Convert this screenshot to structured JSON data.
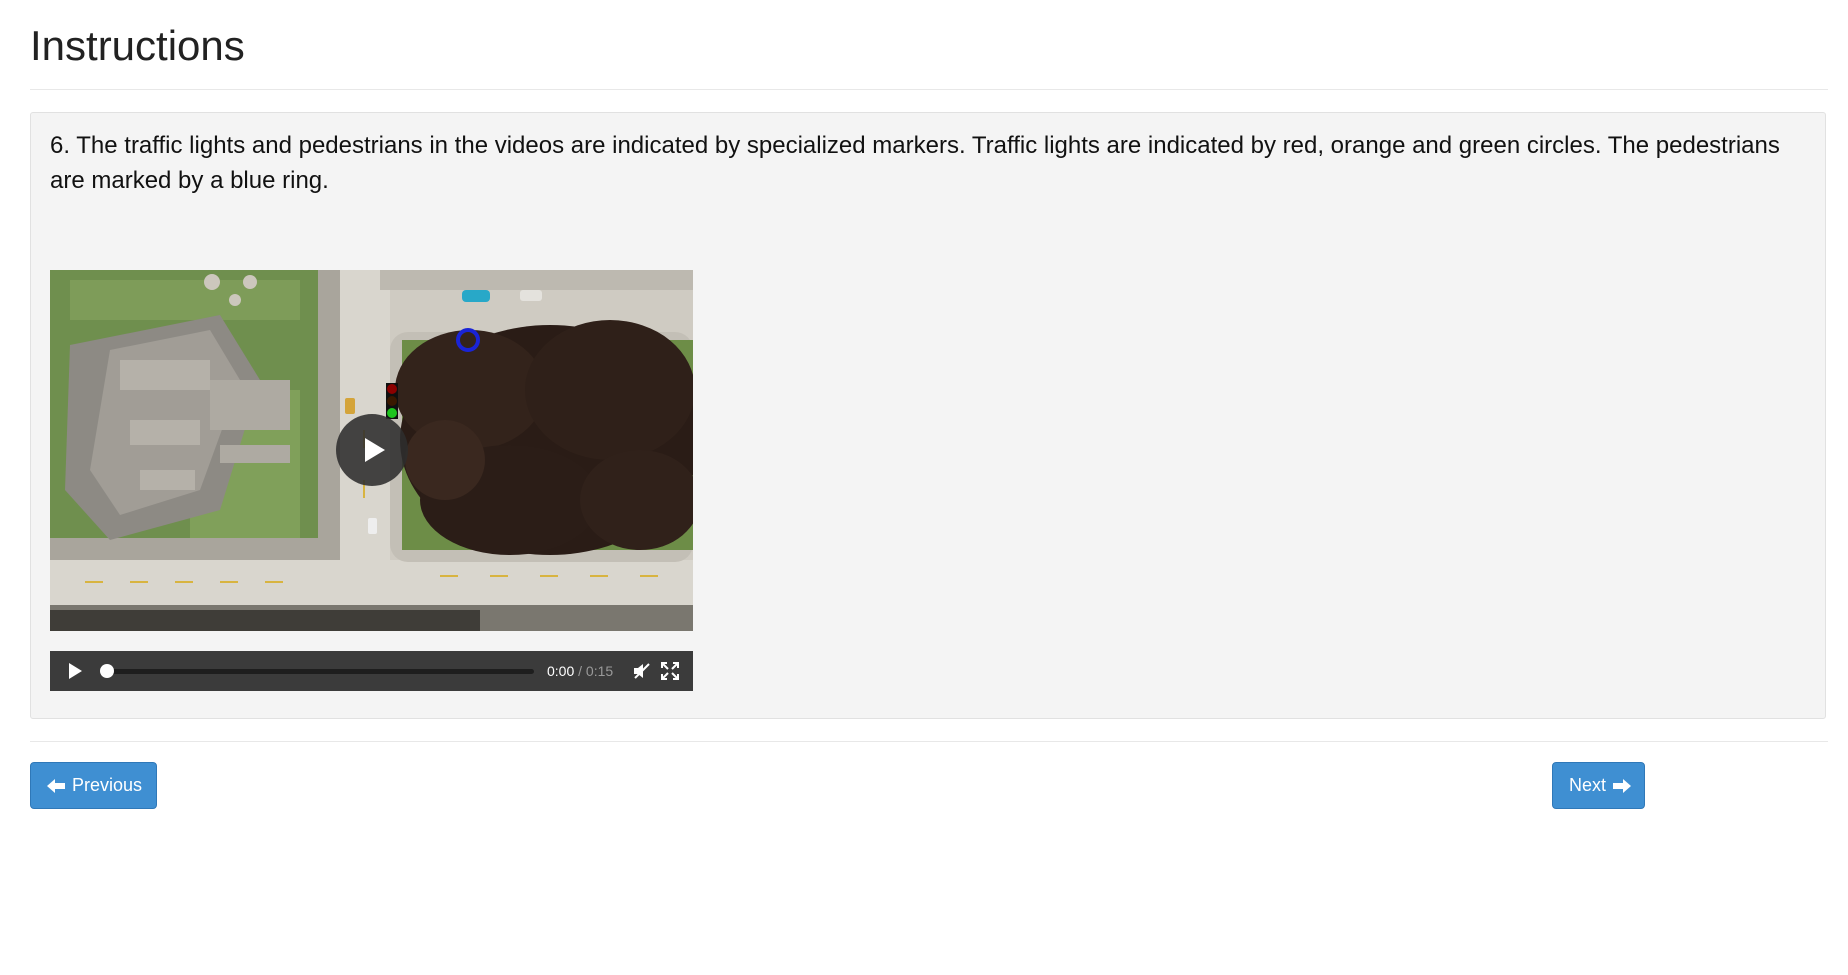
{
  "header": {
    "title": "Instructions"
  },
  "panel": {
    "instruction_text": "6. The traffic lights and pedestrians in the videos are indicated by specialized markers. Traffic lights are indicated by red, orange and green circles. The pedestrians are marked by a blue ring."
  },
  "video": {
    "current_time": "0:00",
    "separator": " / ",
    "duration": "0:15",
    "progress": 0,
    "muted": true,
    "marker_colors": {
      "traffic_light_red": "#8b0000",
      "traffic_light_orange": "#3a1800",
      "traffic_light_green": "#1ec41e",
      "pedestrian_ring": "#1a24d6"
    }
  },
  "navigation": {
    "previous_label": "Previous",
    "next_label": "Next",
    "previous_icon": "arrow-left-icon",
    "next_icon": "arrow-right-icon",
    "button_color": "#3f8fd2"
  }
}
